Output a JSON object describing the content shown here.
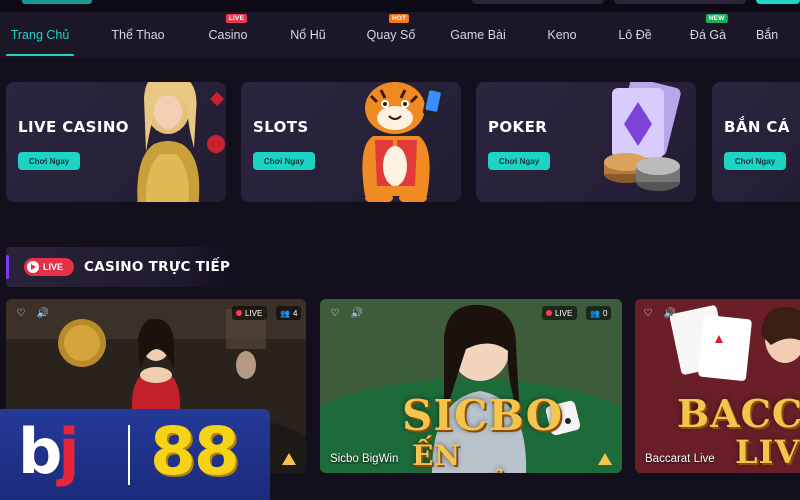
{
  "nav": {
    "items": [
      {
        "label": "Trang Chủ",
        "active": true
      },
      {
        "label": "Thể Thao"
      },
      {
        "label": "Casino",
        "badge": "LIVE",
        "badge_type": "live"
      },
      {
        "label": "Nổ Hũ"
      },
      {
        "label": "Quay Số",
        "badge": "HOT",
        "badge_type": "hot"
      },
      {
        "label": "Game Bài"
      },
      {
        "label": "Keno"
      },
      {
        "label": "Lô Đề"
      },
      {
        "label": "Đá Gà",
        "badge": "NEW",
        "badge_type": "new"
      },
      {
        "label": "Bắn"
      }
    ]
  },
  "categories": [
    {
      "title": "LIVE CASINO",
      "button": "Chơi Ngay",
      "art": "casino-dealer-icon"
    },
    {
      "title": "SLOTS",
      "button": "Chơi Ngay",
      "art": "tiger-mascot-icon"
    },
    {
      "title": "POKER",
      "button": "Chơi Ngay",
      "art": "cards-chips-icon"
    },
    {
      "title": "BẮN CÁ",
      "button": "Chơi Ngay",
      "art": "fish-icon"
    }
  ],
  "section": {
    "live_badge": "LIVE",
    "title": "CASINO TRỰC TIẾP"
  },
  "live_tables": [
    {
      "name": "",
      "live": "LIVE",
      "viewers": "4",
      "big_text": ""
    },
    {
      "name": "Sicbo BigWin",
      "live": "LIVE",
      "viewers": "0",
      "big_text": "SICBO",
      "big_text_2": "ẾN THƯỞNG"
    },
    {
      "name": "Baccarat Live",
      "live": "",
      "viewers": "",
      "big_text": "BACCA",
      "big_text_2": "LIV"
    }
  ],
  "brand": {
    "b": "b",
    "j": "j",
    "number": "88"
  },
  "colors": {
    "accent": "#22d3c5",
    "live": "#e62f48",
    "hot": "#f07a1a",
    "new": "#1fae5e",
    "section_bar": "#7a3cff",
    "brand_blue": "#243a98",
    "brand_gold": "#f5d316"
  }
}
